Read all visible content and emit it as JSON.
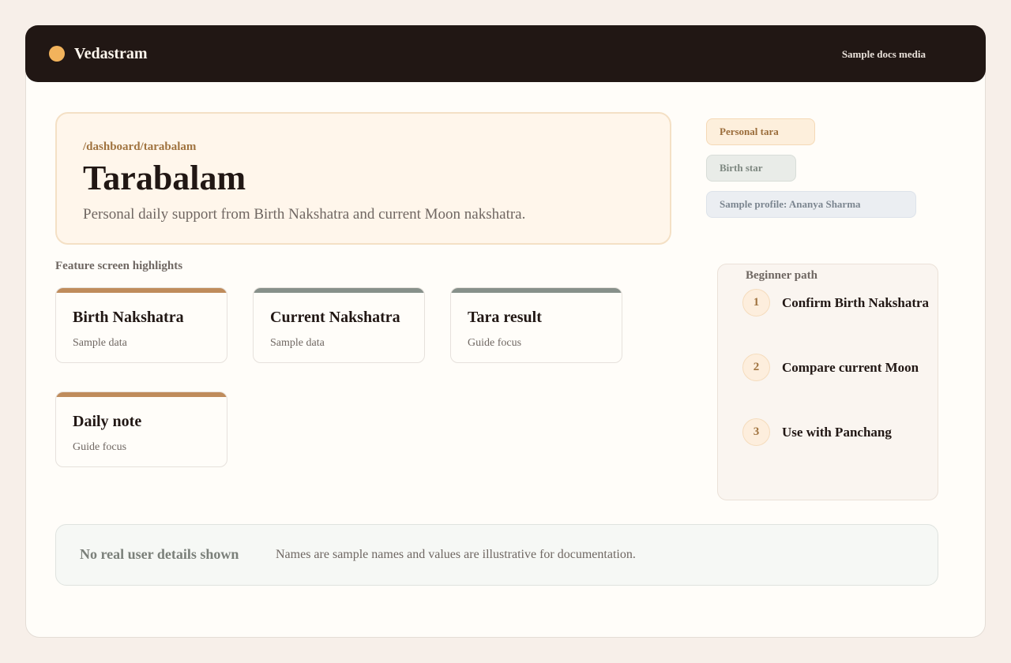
{
  "header": {
    "brand": "Vedastram",
    "link": "Sample docs media",
    "brand_color": "#f2b35c"
  },
  "hero": {
    "path": "/dashboard/tarabalam",
    "title": "Tarabalam",
    "subtitle": "Personal daily support from Birth Nakshatra and current Moon nakshatra."
  },
  "tags": [
    {
      "label": "Personal tara"
    },
    {
      "label": "Birth star"
    },
    {
      "label": "Sample profile: Ananya Sharma"
    }
  ],
  "highlights": {
    "label": "Feature screen highlights",
    "cards": [
      {
        "title": "Birth Nakshatra",
        "meta": "Sample data",
        "accent": "#bf8c5c"
      },
      {
        "title": "Current Nakshatra",
        "meta": "Sample data",
        "accent": "#87908a"
      },
      {
        "title": "Tara result",
        "meta": "Guide focus",
        "accent": "#87908a"
      },
      {
        "title": "Daily note",
        "meta": "Guide focus",
        "accent": "#bf8c5c"
      }
    ]
  },
  "beginner_path": {
    "label": "Beginner path",
    "steps": [
      {
        "num": "1",
        "text": "Confirm Birth Nakshatra"
      },
      {
        "num": "2",
        "text": "Compare current Moon"
      },
      {
        "num": "3",
        "text": "Use with Panchang"
      }
    ]
  },
  "notice": {
    "title": "No real user details shown",
    "text": "Names are sample names and values are illustrative for documentation."
  }
}
